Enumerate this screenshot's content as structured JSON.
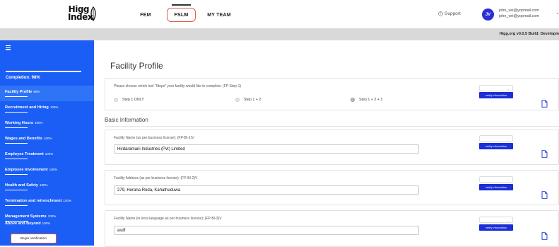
{
  "header": {
    "logo_text_line1": "Higg",
    "logo_text_line2": "Index",
    "nav": [
      {
        "label": "FEM"
      },
      {
        "label": "FSLM"
      },
      {
        "label": "MY TEAM"
      }
    ],
    "support_label": "Support",
    "avatar_initials": "JV",
    "user_email_1": "john_vei@yopmail.com",
    "user_email_2": "john_vei@yopmail.com",
    "build_text": "Higg.org v0.0.5 Build: Developm"
  },
  "sidebar": {
    "completion_label": "Completion: 98%",
    "completion_fraction": 0.98,
    "items": [
      {
        "label": "Facility Profile",
        "pct": "90%",
        "active": true
      },
      {
        "label": "Recruitment and Hiring",
        "pct": "100%"
      },
      {
        "label": "Working Hours",
        "pct": "100%"
      },
      {
        "label": "Wages and Benefits",
        "pct": "100%"
      },
      {
        "label": "Employee Treatment",
        "pct": "100%"
      },
      {
        "label": "Employee Involvement",
        "pct": "100%"
      },
      {
        "label": "Health and Safety",
        "pct": "100%"
      },
      {
        "label": "Termination and retrenchment",
        "pct": "100%"
      },
      {
        "label": "Management Systems",
        "pct": "100%"
      },
      {
        "label": "Above and Beyond",
        "pct": "100%"
      }
    ],
    "begin_button": "Begin Verification"
  },
  "main": {
    "title": "Facility Profile",
    "steps_question": "Please choose which tool \"Steps\" your facility would like to complete: (FP-Step-1)",
    "steps_options": [
      {
        "label": "Step 1 ONLY",
        "selected": false
      },
      {
        "label": "Step 1 + 2",
        "selected": false
      },
      {
        "label": "Step 1 + 2 + 3",
        "selected": true
      }
    ],
    "verify_label": "verify information",
    "select_placeholder": "-",
    "section_title": "Basic Information",
    "fields": [
      {
        "label": "Facility Name (as per business license): (FP-BI-1)V",
        "value": "Hirdaramani Industries (Pvt) Limited"
      },
      {
        "label": "Facility Address (as per business license): (FP-BI-2)V",
        "value": "279, Horana Roda, Kahathuduwa"
      },
      {
        "label": "Facility Name (in local language as per business license): (FP-BI-3)V",
        "value": "asdf"
      }
    ]
  }
}
